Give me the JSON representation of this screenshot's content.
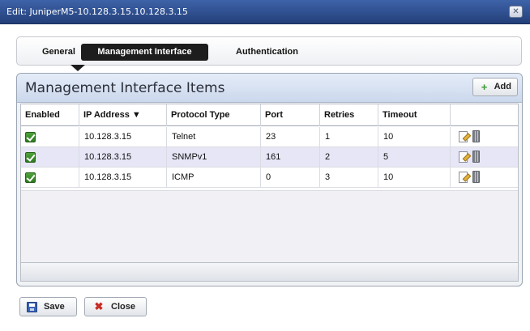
{
  "window": {
    "title": "Edit: JuniperM5-10.128.3.15.10.128.3.15",
    "close_glyph": "✕"
  },
  "tabs": [
    {
      "label": "General",
      "selected": false
    },
    {
      "label": "Management Interface",
      "selected": true
    },
    {
      "label": "Authentication",
      "selected": false
    }
  ],
  "panel": {
    "title": "Management Interface Items",
    "add_label": "Add"
  },
  "table": {
    "columns": [
      "Enabled",
      "IP Address",
      "Protocol Type",
      "Port",
      "Retries",
      "Timeout",
      ""
    ],
    "sort_indicator": "▼",
    "rows": [
      {
        "enabled": true,
        "ip": "10.128.3.15",
        "protocol": "Telnet",
        "port": "23",
        "retries": "1",
        "timeout": "10"
      },
      {
        "enabled": true,
        "ip": "10.128.3.15",
        "protocol": "SNMPv1",
        "port": "161",
        "retries": "2",
        "timeout": "5"
      },
      {
        "enabled": true,
        "ip": "10.128.3.15",
        "protocol": "ICMP",
        "port": "0",
        "retries": "3",
        "timeout": "10"
      }
    ]
  },
  "footer": {
    "save_label": "Save",
    "close_label": "Close"
  },
  "icons": {
    "checkbox": "checkbox-checked-icon",
    "edit": "edit-icon",
    "delete": "trash-icon",
    "save": "floppy-disk-icon",
    "close": "close-x-icon",
    "add": "plus-icon"
  },
  "colors": {
    "titlebar": "#2f4f8f",
    "selected_tab": "#1d1d1d",
    "alt_row": "#e6e6f7",
    "check": "#3c9a36",
    "close_x": "#c62c22"
  }
}
